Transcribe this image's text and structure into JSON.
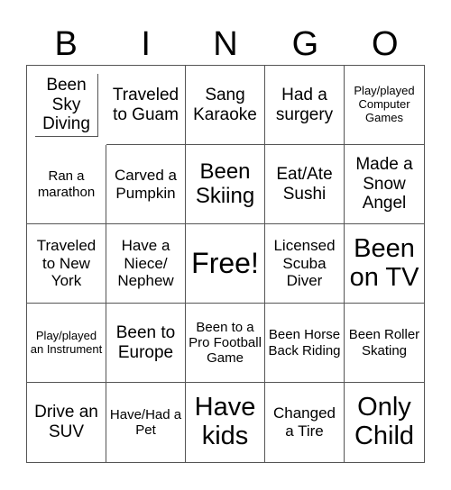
{
  "header": [
    "B",
    "I",
    "N",
    "G",
    "O"
  ],
  "cells": [
    "Been Sky Diving",
    "Traveled to Guam",
    "Sang Karaoke",
    "Had a surgery",
    "Play/played Computer Games",
    "Ran a marathon",
    "Carved a Pumpkin",
    "Been Skiing",
    "Eat/Ate Sushi",
    "Made a Snow Angel",
    "Traveled to New York",
    "Have a Niece/ Nephew",
    "Free!",
    "Licensed Scuba Diver",
    "Been on TV",
    "Play/played an Instrument",
    "Been to Europe",
    "Been to a Pro Football Game",
    "Been Horse Back Riding",
    "Been Roller Skating",
    "Drive an SUV",
    "Have/Had a Pet",
    "Have kids",
    "Changed a Tire",
    "Only Child"
  ]
}
